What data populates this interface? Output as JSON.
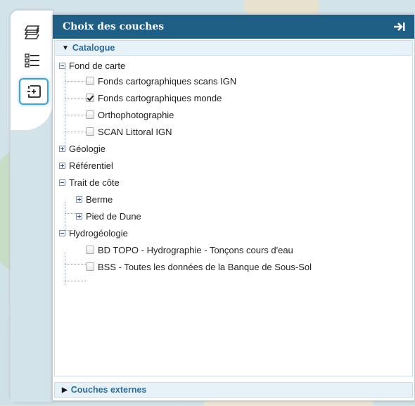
{
  "panel": {
    "title": "Choix des couches",
    "collapse_icon": "arrow-right-bar-icon"
  },
  "side_tabs": [
    {
      "icon": "layers-icon",
      "active": false
    },
    {
      "icon": "legend-list-icon",
      "active": false
    },
    {
      "icon": "add-layer-icon",
      "active": true
    }
  ],
  "catalogue": {
    "label": "Catalogue",
    "expanded": true,
    "groups": [
      {
        "label": "Fond de carte",
        "expanded": true,
        "layers": [
          {
            "label": "Fonds cartographiques scans IGN",
            "checked": false
          },
          {
            "label": "Fonds cartographiques monde",
            "checked": true
          },
          {
            "label": "Orthophotographie",
            "checked": false
          },
          {
            "label": "SCAN Littoral IGN",
            "checked": false
          }
        ]
      },
      {
        "label": "Géologie",
        "expanded": false
      },
      {
        "label": "Référentiel",
        "expanded": false
      },
      {
        "label": "Trait de côte",
        "expanded": true,
        "subgroups": [
          {
            "label": "Berme",
            "expanded": false
          },
          {
            "label": "Pied de Dune",
            "expanded": false
          }
        ]
      },
      {
        "label": "Hydrogéologie",
        "expanded": true,
        "layers": [
          {
            "label": "BD TOPO - Hydrographie - Tonçons cours d'eau",
            "checked": false
          },
          {
            "label": "BSS - Toutes les données de la Banque de Sous-Sol",
            "checked": false
          }
        ]
      }
    ]
  },
  "external": {
    "label": "Couches externes",
    "expanded": false
  },
  "colors": {
    "header_bg": "#1f5f86",
    "section_text": "#2a6ea0",
    "active_tab_border": "#3aa3d8"
  }
}
